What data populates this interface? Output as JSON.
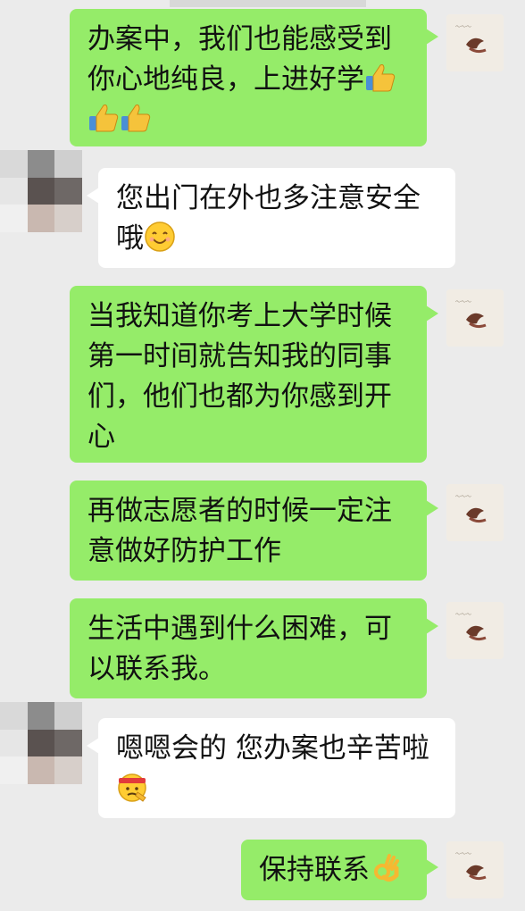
{
  "messages": [
    {
      "side": "self",
      "text_lines": [
        "办案中，我们也能感受到",
        "你心地纯良，上进好学"
      ],
      "trailing_emoji": "thumbs-up",
      "extra_line_emojis": [
        "thumbs-up",
        "thumbs-up"
      ]
    },
    {
      "side": "other",
      "text_lines": [
        "您出门在外也多注意安全",
        "哦"
      ],
      "trailing_emoji": "smile"
    },
    {
      "side": "self",
      "text_lines": [
        "当我知道你考上大学时候",
        "第一时间就告知我的同事",
        "们，他们也都为你感到开",
        "心"
      ]
    },
    {
      "side": "self",
      "text_lines": [
        "再做志愿者的时候一定注",
        "意做好防护工作"
      ]
    },
    {
      "side": "self",
      "text_lines": [
        "生活中遇到什么困难，可",
        "以联系我。"
      ]
    },
    {
      "side": "other",
      "text_lines": [
        "嗯嗯会的 您办案也辛苦啦"
      ],
      "extra_line_emojis": [
        "salute-headband"
      ]
    },
    {
      "side": "self",
      "text_lines": [
        "保持联系"
      ],
      "trailing_emoji": "ok-hand"
    }
  ],
  "colors": {
    "background": "#ebebeb",
    "self_bubble": "#95ec69",
    "other_bubble": "#ffffff",
    "text": "#111111"
  },
  "icons": {
    "self_avatar": "profile-photo-bird-icon",
    "other_avatar": "pixelated-profile-photo-icon"
  }
}
